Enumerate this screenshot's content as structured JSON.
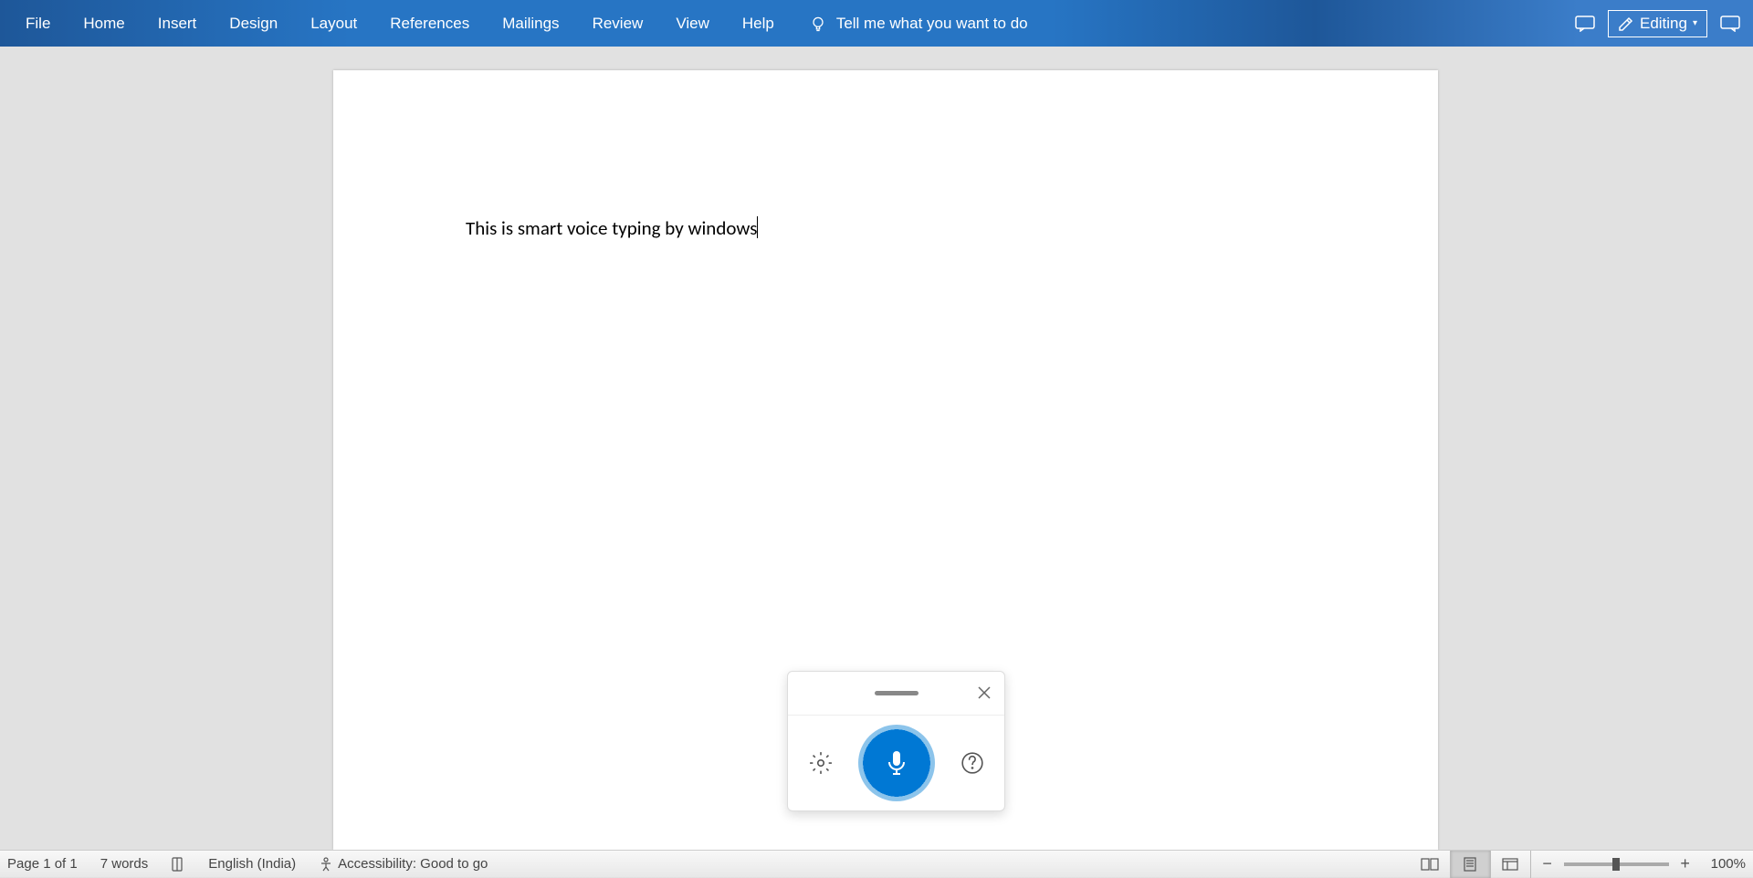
{
  "tabs": {
    "file": "File",
    "home": "Home",
    "insert": "Insert",
    "design": "Design",
    "layout": "Layout",
    "references": "References",
    "mailings": "Mailings",
    "review": "Review",
    "view": "View",
    "help": "Help"
  },
  "tellMe": "Tell me what you want to do",
  "editing": "Editing",
  "document": {
    "text": "This is smart voice typing by windows"
  },
  "statusBar": {
    "page": "Page 1 of 1",
    "words": "7 words",
    "language": "English (India)",
    "accessibility": "Accessibility: Good to go",
    "zoom": "100%"
  }
}
